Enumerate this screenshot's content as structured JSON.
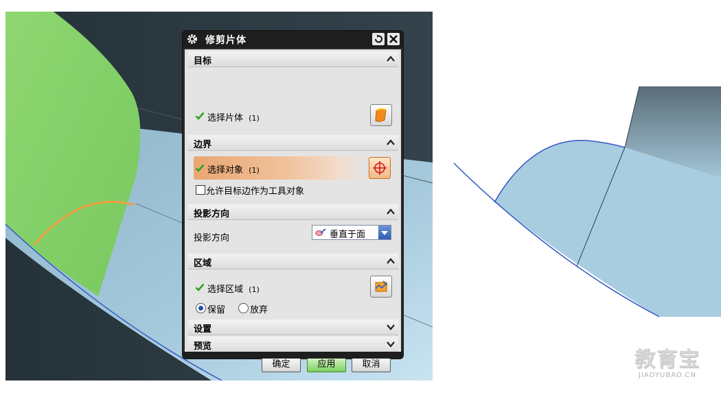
{
  "dialog": {
    "title": "修剪片体",
    "title_buttons": {
      "reset_icon": "reset-icon",
      "close_icon": "close-icon"
    },
    "sections": {
      "target": {
        "label": "目标",
        "select_body": {
          "label": "选择片体",
          "count": "(1)"
        }
      },
      "boundary": {
        "label": "边界",
        "select_object": {
          "label": "选择对象",
          "count": "(1)"
        },
        "allow_target_edge": {
          "label": "允许目标边作为工具对象",
          "checked": false
        }
      },
      "projection": {
        "label": "投影方向",
        "field_label": "投影方向",
        "selected_option": "垂直于面"
      },
      "region": {
        "label": "区域",
        "select_region": {
          "label": "选择区域",
          "count": "(1)"
        },
        "keep_label": "保留",
        "discard_label": "放弃",
        "selected": "keep"
      },
      "settings": {
        "label": "设置"
      },
      "preview": {
        "label": "预览"
      }
    },
    "buttons": {
      "ok": "确定",
      "apply": "应用",
      "cancel": "取消"
    }
  },
  "watermark": {
    "main": "教育宝",
    "sub": "JIAOYUBAO.CN"
  },
  "colors": {
    "viewport_bg": "#2e3c44",
    "surface_green": "#86d36b",
    "surface_blue": "#a9cde0",
    "highlight_orange": "#eeaa6e",
    "curve_orange": "#f0a040",
    "edge_blue": "#3257c4"
  }
}
